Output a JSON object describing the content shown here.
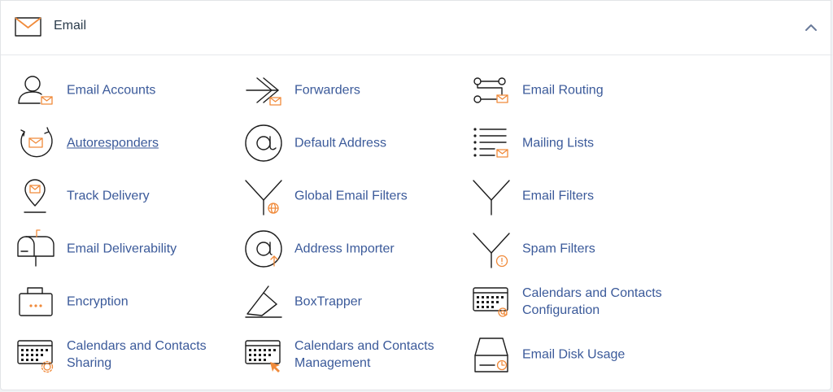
{
  "section": {
    "title": "Email",
    "icon": "envelope-icon",
    "collapse_icon": "chevron-up-icon"
  },
  "colors": {
    "link": "#3b5a9a",
    "accent": "#f08a3a",
    "icon": "#1c1c1c"
  },
  "items": [
    {
      "label": "Email Accounts",
      "icon": "email-accounts-icon"
    },
    {
      "label": "Forwarders",
      "icon": "forwarders-icon"
    },
    {
      "label": "Email Routing",
      "icon": "email-routing-icon"
    },
    {
      "label": "Autoresponders",
      "icon": "autoresponders-icon"
    },
    {
      "label": "Default Address",
      "icon": "default-address-icon"
    },
    {
      "label": "Mailing Lists",
      "icon": "mailing-lists-icon"
    },
    {
      "label": "Track Delivery",
      "icon": "track-delivery-icon"
    },
    {
      "label": "Global Email Filters",
      "icon": "global-email-filters-icon"
    },
    {
      "label": "Email Filters",
      "icon": "email-filters-icon"
    },
    {
      "label": "Email Deliverability",
      "icon": "email-deliverability-icon"
    },
    {
      "label": "Address Importer",
      "icon": "address-importer-icon"
    },
    {
      "label": "Spam Filters",
      "icon": "spam-filters-icon"
    },
    {
      "label": "Encryption",
      "icon": "encryption-icon"
    },
    {
      "label": "BoxTrapper",
      "icon": "boxtrapper-icon"
    },
    {
      "label_line1": "Calendars and Contacts",
      "label_line2": "Configuration",
      "icon": "calendars-contacts-configuration-icon"
    },
    {
      "label_line1": "Calendars and Contacts",
      "label_line2": "Sharing",
      "icon": "calendars-contacts-sharing-icon"
    },
    {
      "label_line1": "Calendars and Contacts",
      "label_line2": "Management",
      "icon": "calendars-contacts-management-icon"
    },
    {
      "label": "Email Disk Usage",
      "icon": "email-disk-usage-icon"
    }
  ]
}
